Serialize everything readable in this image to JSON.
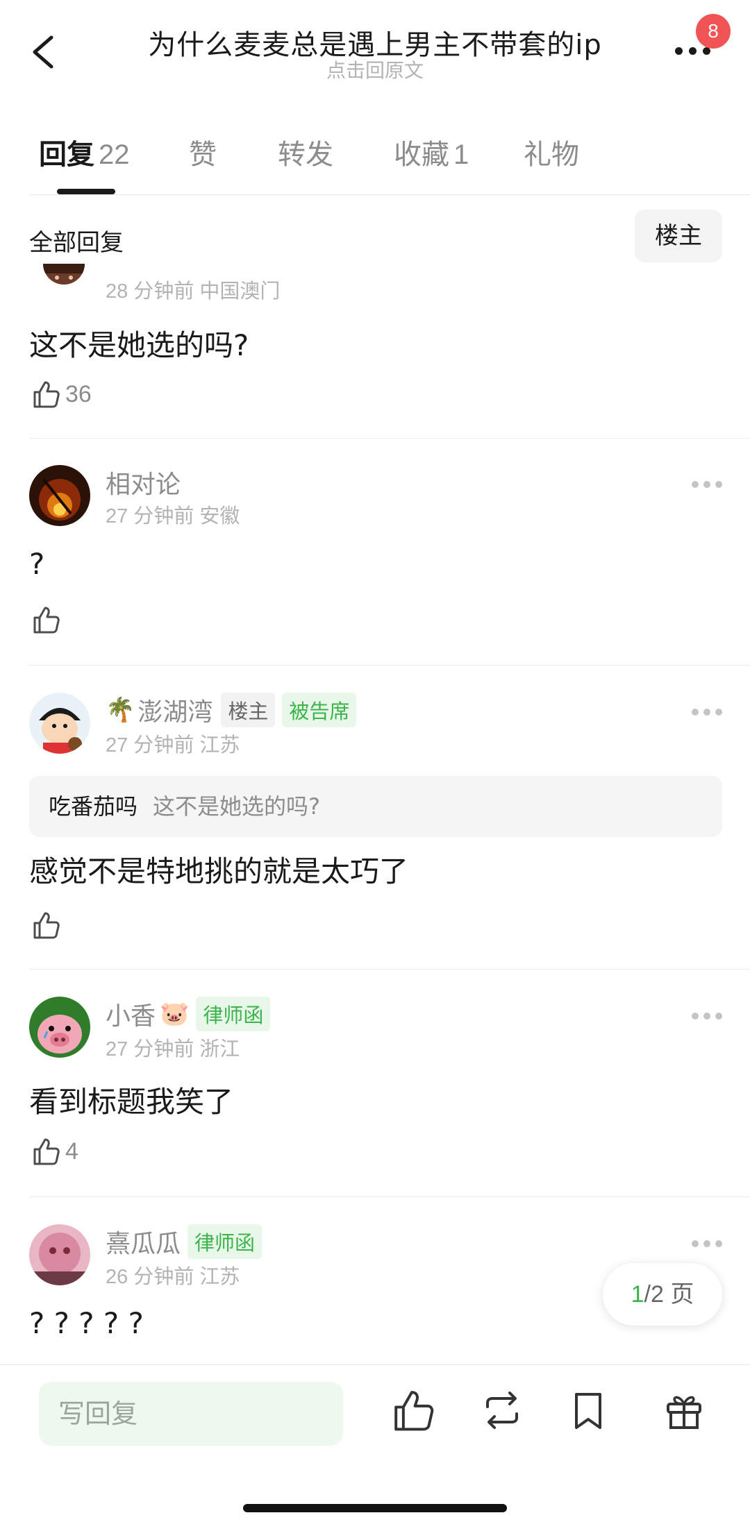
{
  "header": {
    "title": "为什么麦麦总是遇上男主不带套的ip",
    "subtitle": "点击回原文",
    "notification_count": "8"
  },
  "tabs": [
    {
      "label": "回复",
      "count": "22"
    },
    {
      "label": "赞",
      "count": ""
    },
    {
      "label": "转发",
      "count": ""
    },
    {
      "label": "收藏",
      "count": "1"
    },
    {
      "label": "礼物",
      "count": ""
    }
  ],
  "section": {
    "title": "全部回复",
    "filter_label": "楼主"
  },
  "comments": [
    {
      "username": "",
      "time": "28 分钟前",
      "location": "中国澳门",
      "content": "这不是她选的吗?",
      "likes": "36"
    },
    {
      "username": "相对论",
      "time": "27 分钟前",
      "location": "安徽",
      "content": "?",
      "likes": ""
    },
    {
      "username": "澎湖湾",
      "name_emoji": "🌴",
      "tags": [
        "楼主",
        "被告席"
      ],
      "time": "27 分钟前",
      "location": "江苏",
      "quote_user": "吃番茄吗",
      "quote_text": "这不是她选的吗?",
      "content": "感觉不是特地挑的就是太巧了",
      "likes": ""
    },
    {
      "username": "小香",
      "name_emoji": "🐷",
      "tags": [
        "律师函"
      ],
      "time": "27 分钟前",
      "location": "浙江",
      "content": "看到标题我笑了",
      "likes": "4"
    },
    {
      "username": "熹瓜瓜",
      "tags": [
        "律师函"
      ],
      "time": "26 分钟前",
      "location": "江苏",
      "content": "? ? ? ? ?",
      "likes": ""
    }
  ],
  "pagination": {
    "current": "1",
    "total": "/2 页"
  },
  "bottom_bar": {
    "reply_placeholder": "写回复"
  },
  "colors": {
    "accent_green": "#3bb54a",
    "badge_red": "#f05454"
  }
}
